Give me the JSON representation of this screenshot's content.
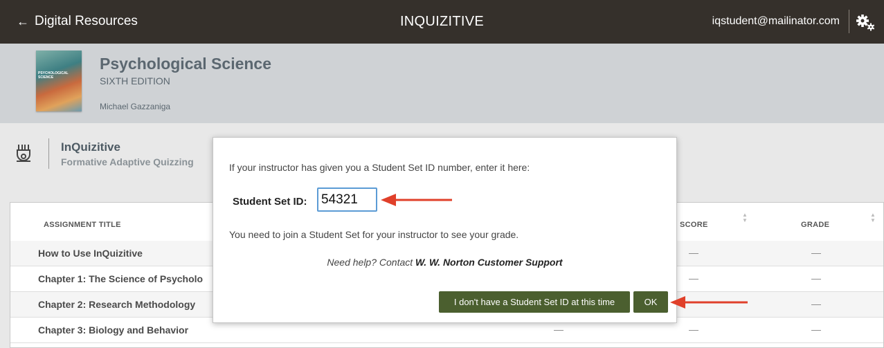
{
  "topbar": {
    "back_label": "Digital Resources",
    "app_title": "INQUIZITIVE",
    "user_email": "iqstudent@mailinator.com"
  },
  "book": {
    "title": "Psychological Science",
    "edition": "SIXTH EDITION",
    "author": "Michael Gazzaniga",
    "cover_text": "PSYCHOLOGICAL SCIENCE"
  },
  "product": {
    "title": "InQuizitive",
    "subtitle": "Formative Adaptive Quizzing"
  },
  "table": {
    "headers": {
      "title": "ASSIGNMENT TITLE",
      "score": "SCORE",
      "grade": "GRADE"
    },
    "rows": [
      {
        "title": "How to Use InQuizitive",
        "due": "",
        "score": "—",
        "grade": "—"
      },
      {
        "title": "Chapter 1: The Science of Psycholo",
        "due": "",
        "score": "—",
        "grade": "—"
      },
      {
        "title": "Chapter 2: Research Methodology",
        "due": "",
        "score": "",
        "grade": "—"
      },
      {
        "title": "Chapter 3: Biology and Behavior",
        "due": "—",
        "score": "—",
        "grade": "—"
      }
    ]
  },
  "modal": {
    "prompt": "If your instructor has given you a Student Set ID number, enter it here:",
    "field_label": "Student Set ID:",
    "field_value": "54321",
    "note": "You need to join a Student Set for your instructor to see your grade.",
    "help_prefix": "Need help? Contact ",
    "help_link": "W. W. Norton Customer Support",
    "no_id_button": "I don't have a Student Set ID at this time",
    "ok_button": "OK"
  },
  "colors": {
    "topbar": "#35302b",
    "button": "#4b5f2f",
    "annotation_arrow": "#e0402a",
    "input_focus": "#5b9bd5"
  }
}
